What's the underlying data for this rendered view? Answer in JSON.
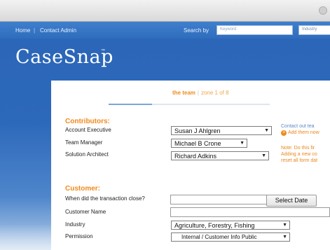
{
  "nav": {
    "home": "Home",
    "separator": "|",
    "contact_admin": "Contact Admin",
    "search_label": "Search by",
    "search_placeholder": "Keyword",
    "industry_label": "Industry"
  },
  "brand": {
    "name": "CaseSnap",
    "trademark": "™"
  },
  "steps": {
    "current": "the team",
    "separator": "|",
    "zone": "zone 1 of 8"
  },
  "contributors": {
    "title": "Contributors:",
    "fields": [
      {
        "label": "Account Executive",
        "value": "Susan J Ahlgren"
      },
      {
        "label": "Team Manager",
        "value": "Michael B Crone"
      },
      {
        "label": "Solution Architect",
        "value": "Richard Adkins"
      }
    ],
    "note_contact": "Contact out tea",
    "note_add": "Add them now",
    "note_warning": [
      "Note: Do this fir",
      "Adding a new co",
      "reset all form dat"
    ]
  },
  "customer": {
    "title": "Customer:",
    "close_label": "When did the transaction close?",
    "close_value": "",
    "select_date": "Select Date",
    "name_label": "Customer Name",
    "name_value": "",
    "industry_label": "Industry",
    "industry_value": "Agriculture, Forestry, Fishing",
    "permission_label": "Permission",
    "permission_value": "Internal / Customer Info Public"
  },
  "colors": {
    "accent": "#f08a1c",
    "brand_blue": "#2d69bb"
  },
  "icons": {
    "dropdown": "chevron-down-icon",
    "add": "add-circle-icon"
  }
}
